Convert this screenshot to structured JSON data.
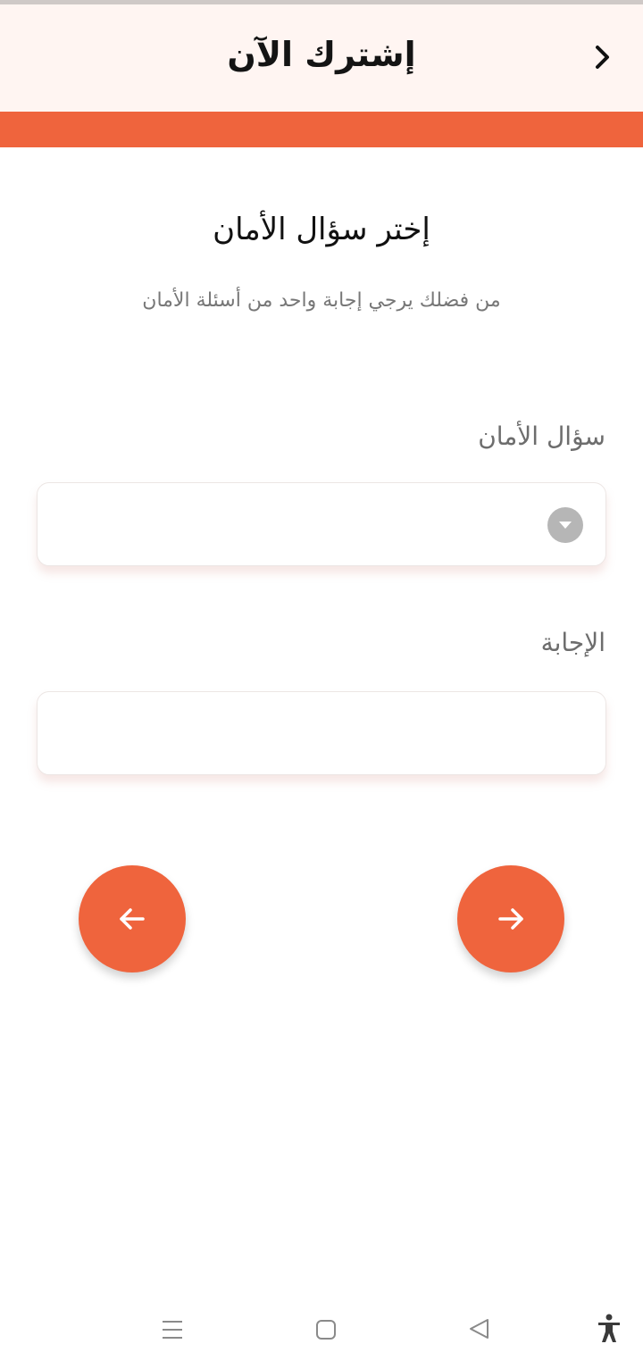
{
  "header": {
    "title": "إشترك الآن",
    "back_icon": "chevron-right-icon"
  },
  "section": {
    "title": "إختر سؤال الأمان",
    "subtitle": "من فضلك يرجي إجابة واحد من أسئلة الأمان"
  },
  "form": {
    "question_label": "سؤال الأمان",
    "question_value": "",
    "answer_label": "الإجابة",
    "answer_value": ""
  },
  "buttons": {
    "previous_icon": "arrow-left-icon",
    "next_icon": "arrow-right-icon"
  },
  "system_nav": {
    "icons": [
      "menu-icon",
      "home-icon",
      "back-triangle-icon",
      "accessibility-icon"
    ]
  },
  "colors": {
    "accent": "#ef643d",
    "header_bg": "#fff5f2"
  }
}
